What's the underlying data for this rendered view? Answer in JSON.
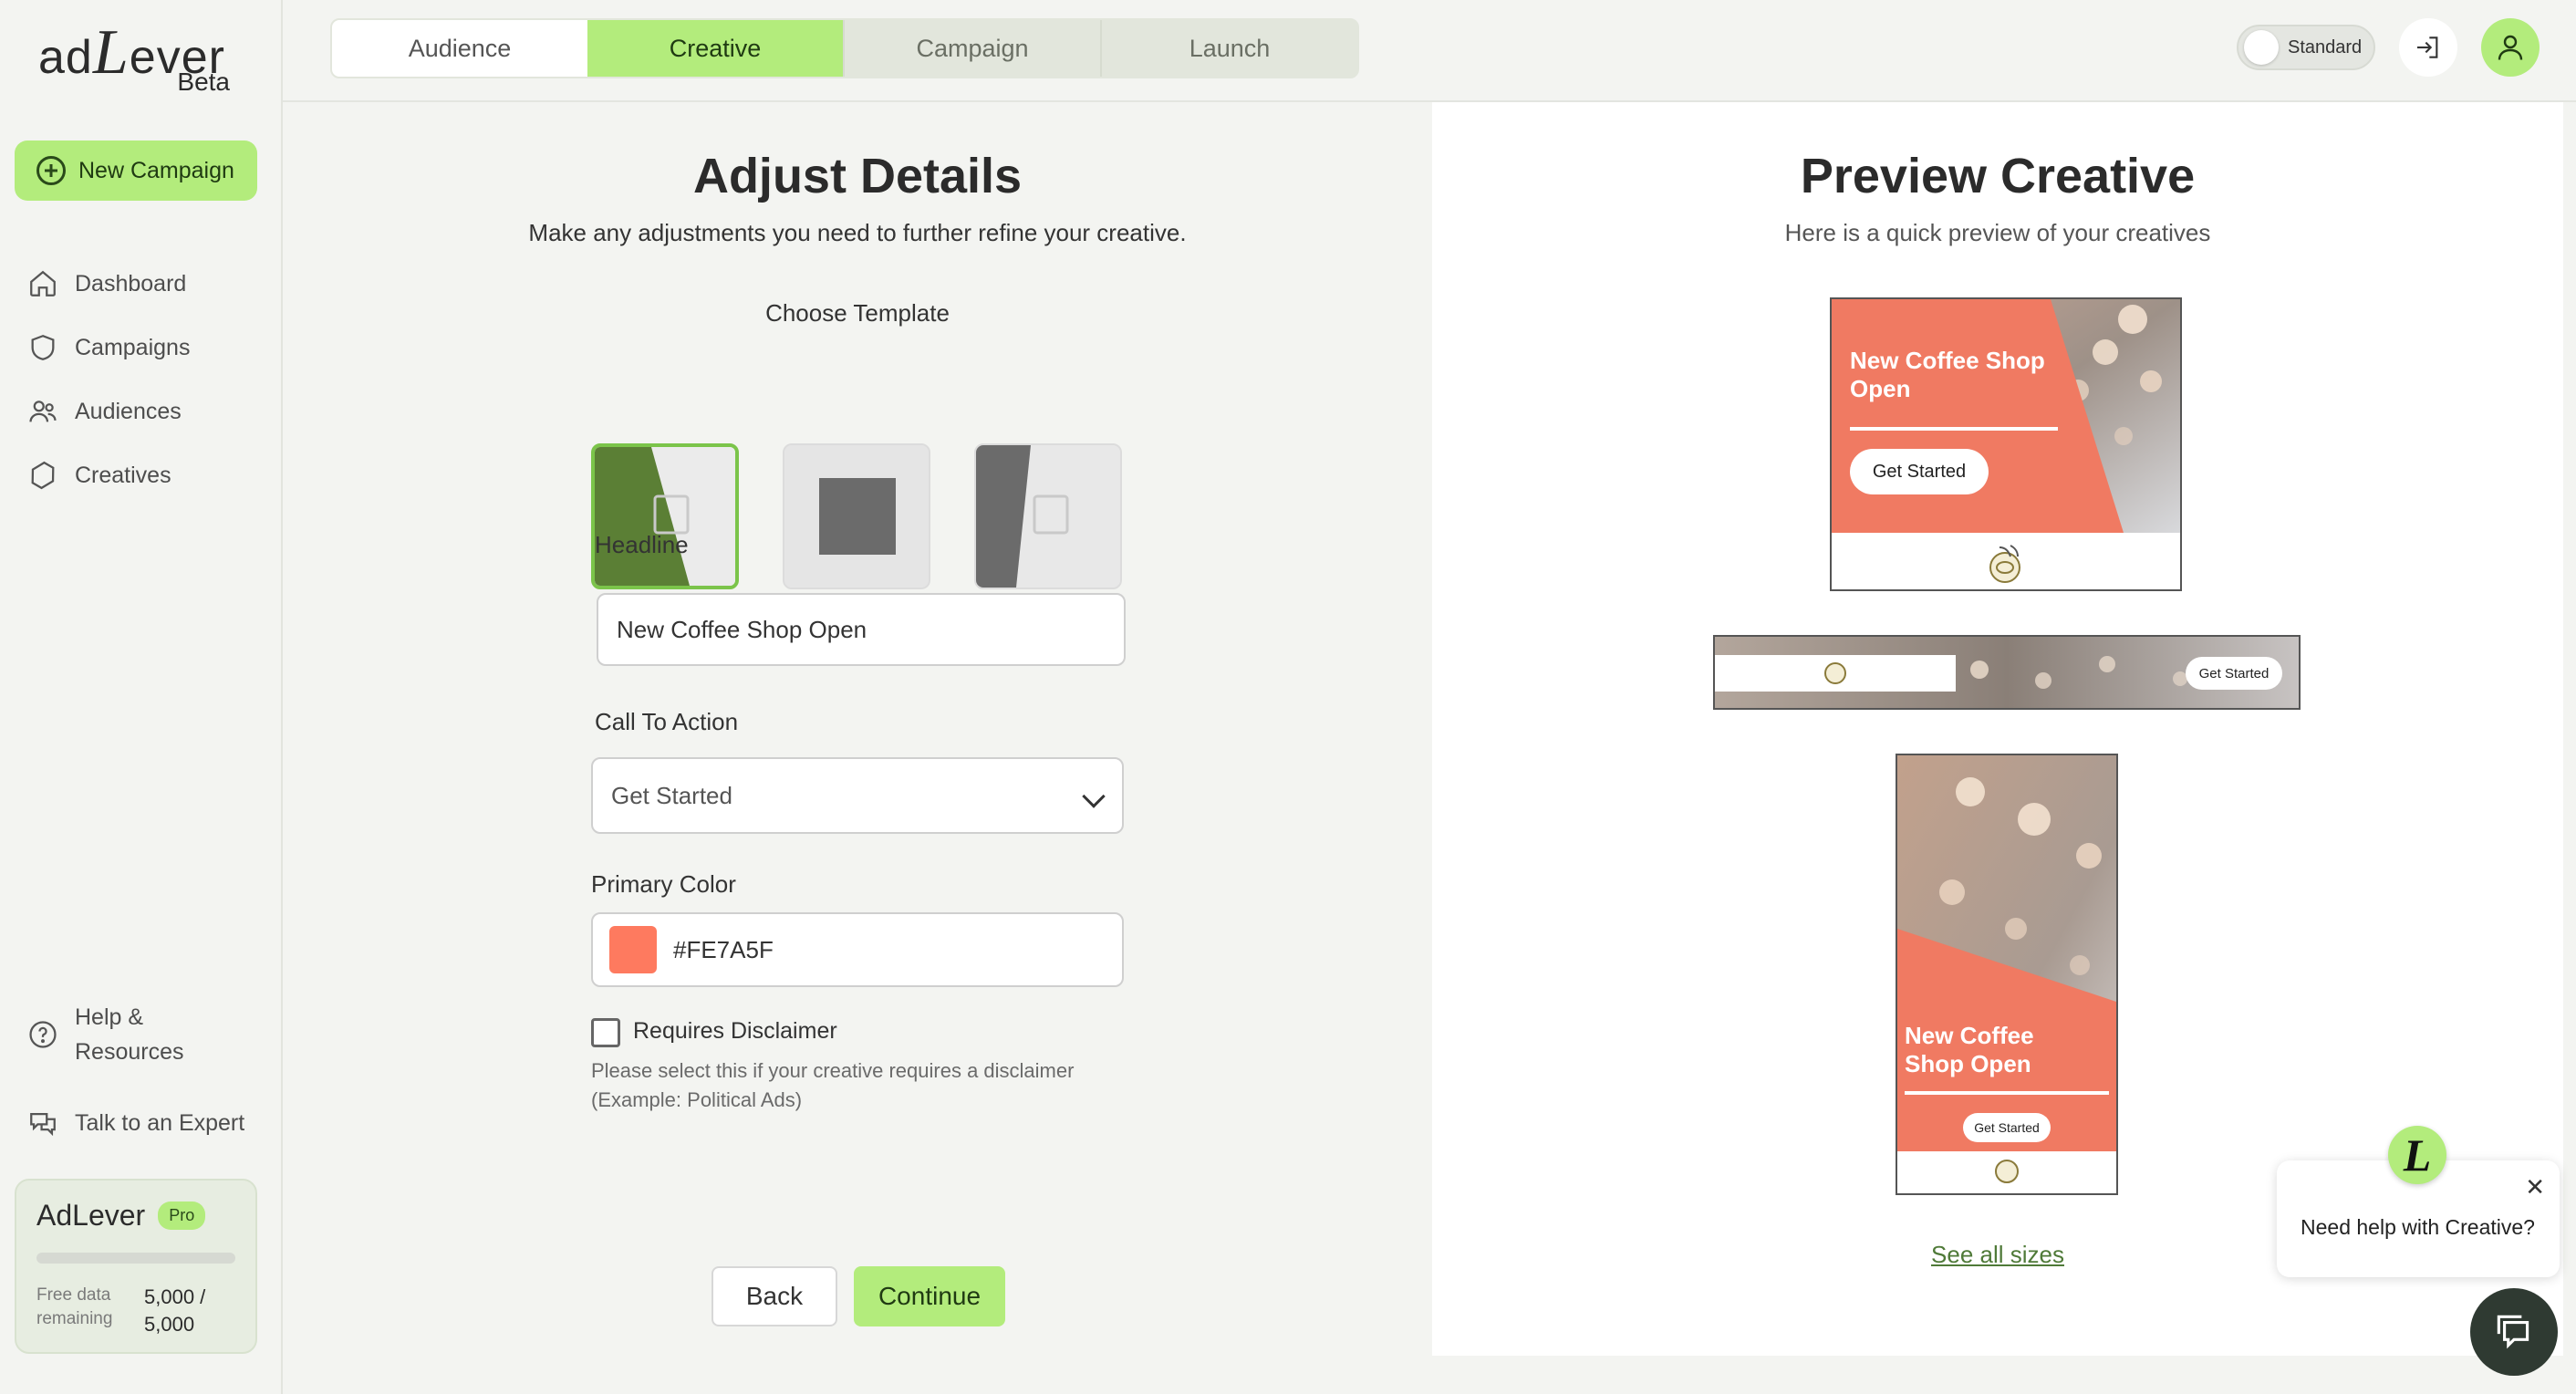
{
  "brand": {
    "logo_text_ad": "ad",
    "logo_text_l": "L",
    "logo_text_ever": "ever",
    "beta": "Beta"
  },
  "sidebar": {
    "new_campaign": "New Campaign",
    "items": [
      {
        "label": "Dashboard",
        "icon": "home-icon"
      },
      {
        "label": "Campaigns",
        "icon": "shield-icon"
      },
      {
        "label": "Audiences",
        "icon": "users-icon"
      },
      {
        "label": "Creatives",
        "icon": "hexagon-icon"
      }
    ],
    "help": "Help &\nResources",
    "help_line1": "Help &",
    "help_line2": "Resources",
    "talk": "Talk to an Expert",
    "pro_card": {
      "title": "AdLever",
      "badge": "Pro",
      "label_line1": "Free data",
      "label_line2": "remaining",
      "value_line1": "5,000 /",
      "value_line2": "5,000",
      "used_fraction": 0
    }
  },
  "steps": [
    {
      "label": "Audience",
      "state": "done"
    },
    {
      "label": "Creative",
      "state": "active"
    },
    {
      "label": "Campaign",
      "state": "future"
    },
    {
      "label": "Launch",
      "state": "future"
    }
  ],
  "topbar": {
    "toggle_label": "Standard"
  },
  "form": {
    "title": "Adjust Details",
    "subtitle": "Make any adjustments you need to further refine your creative.",
    "template_label": "Choose Template",
    "headline_label": "Headline",
    "headline_value": "New Coffee Shop Open",
    "cta_label": "Call To Action",
    "cta_value": "Get Started",
    "color_label": "Primary Color",
    "color_value": "#FE7A5F",
    "disclaimer_label": "Requires Disclaimer",
    "disclaimer_help": "Please select this if your creative requires a disclaimer (Example: Political Ads)",
    "back": "Back",
    "continue": "Continue"
  },
  "preview": {
    "title": "Preview Creative",
    "subtitle": "Here is a quick preview of your creatives",
    "headline_line1": "New Coffee Shop",
    "headline_line2": "Open",
    "tall_line1": "New Coffee",
    "tall_line2": "Shop Open",
    "cta": "Get Started",
    "see_all": "See all sizes"
  },
  "chat": {
    "badge": "L",
    "message": "Need help with Creative?"
  },
  "colors": {
    "accent": "#b3ec7c",
    "primary": "#fe7a5f",
    "dark_green": "#5b7f35"
  }
}
